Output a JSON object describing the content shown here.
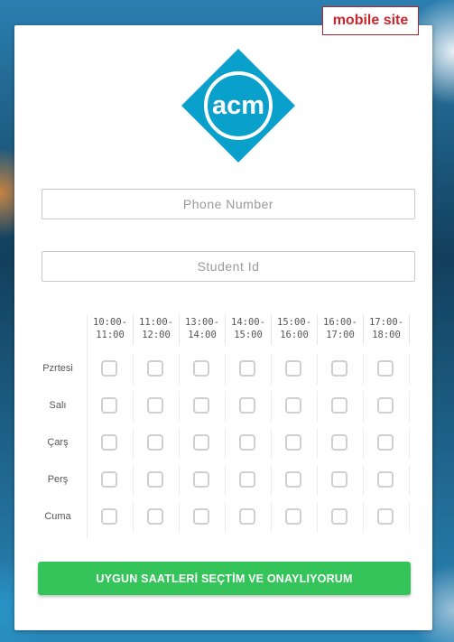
{
  "badge": {
    "label": "mobile site"
  },
  "logo": {
    "text": "acm",
    "color": "#0aa0cc"
  },
  "form": {
    "phone_placeholder": "Phone Number",
    "student_placeholder": "Student Id"
  },
  "schedule": {
    "time_slots": [
      {
        "start": "10:00-",
        "end": "11:00"
      },
      {
        "start": "11:00-",
        "end": "12:00"
      },
      {
        "start": "13:00-",
        "end": "14:00"
      },
      {
        "start": "14:00-",
        "end": "15:00"
      },
      {
        "start": "15:00-",
        "end": "16:00"
      },
      {
        "start": "16:00-",
        "end": "17:00"
      },
      {
        "start": "17:00-",
        "end": "18:00"
      }
    ],
    "days": [
      "Pzrtesi",
      "Salı",
      "Çarş",
      "Perş",
      "Cuma"
    ]
  },
  "submit": {
    "label": "UYGUN SAATLERİ SEÇTİM VE ONAYLIYORUM",
    "color": "#34c45a"
  }
}
